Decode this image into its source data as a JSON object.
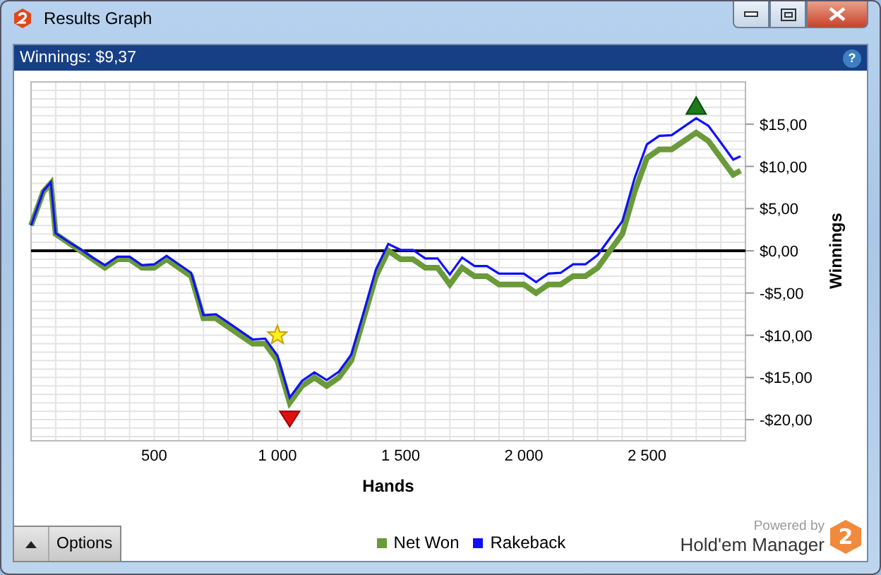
{
  "window": {
    "title": "Results Graph"
  },
  "header": {
    "title": "Winnings: $9,37",
    "help": "?"
  },
  "chart": {
    "chart_data": {
      "type": "line",
      "grid": true,
      "xlabel": "Hands",
      "ylabel": "Winnings",
      "xlim": [
        0,
        2900
      ],
      "ylim": [
        -22.5,
        20
      ],
      "xticks": [
        {
          "value": 500,
          "label": "500"
        },
        {
          "value": 1000,
          "label": "1 000"
        },
        {
          "value": 1500,
          "label": "1 500"
        },
        {
          "value": 2000,
          "label": "2 000"
        },
        {
          "value": 2500,
          "label": "2 500"
        }
      ],
      "yticks": [
        {
          "value": 15,
          "label": "$15,00"
        },
        {
          "value": 10,
          "label": "$10,00"
        },
        {
          "value": 5,
          "label": "$5,00"
        },
        {
          "value": 0,
          "label": "$0,00"
        },
        {
          "value": -5,
          "label": "-$5,00"
        },
        {
          "value": -10,
          "label": "-$10,00"
        },
        {
          "value": -15,
          "label": "-$15,00"
        },
        {
          "value": -20,
          "label": "-$20,00"
        }
      ],
      "x": [
        0,
        50,
        80,
        100,
        150,
        200,
        250,
        300,
        350,
        400,
        450,
        500,
        550,
        600,
        650,
        700,
        750,
        800,
        850,
        900,
        950,
        1000,
        1050,
        1100,
        1150,
        1200,
        1250,
        1300,
        1350,
        1400,
        1450,
        1500,
        1550,
        1600,
        1650,
        1700,
        1750,
        1800,
        1850,
        1900,
        1950,
        2000,
        2050,
        2100,
        2150,
        2200,
        2250,
        2300,
        2350,
        2400,
        2450,
        2500,
        2550,
        2600,
        2650,
        2700,
        2750,
        2800,
        2850,
        2880
      ],
      "series": [
        {
          "name": "Net Won",
          "color": "#6a9a3a",
          "values": [
            3,
            7,
            8,
            2,
            1,
            0,
            -1,
            -2,
            -1,
            -1,
            -2,
            -2,
            -1,
            -2,
            -3,
            -8,
            -8,
            -9,
            -10,
            -11,
            -11,
            -13,
            -18,
            -16,
            -15,
            -16,
            -15,
            -13,
            -8,
            -3,
            0,
            -1,
            -1,
            -2,
            -2,
            -4,
            -2,
            -3,
            -3,
            -4,
            -4,
            -4,
            -5,
            -4,
            -4,
            -3,
            -3,
            -2,
            0,
            2,
            7,
            11,
            12,
            12,
            13,
            14,
            13,
            11,
            9,
            9.5
          ]
        },
        {
          "name": "Rakeback",
          "color": "#1010ff",
          "values": [
            3,
            7.1,
            8.1,
            2.1,
            1.1,
            0.2,
            -0.8,
            -1.7,
            -0.7,
            -0.7,
            -1.7,
            -1.6,
            -0.6,
            -1.6,
            -2.6,
            -7.6,
            -7.5,
            -8.5,
            -9.5,
            -10.5,
            -10.4,
            -12.4,
            -17.4,
            -15.4,
            -14.4,
            -15.3,
            -14.3,
            -12.3,
            -7.3,
            -2.2,
            0.8,
            0.1,
            0.1,
            -0.9,
            -0.9,
            -2.8,
            -0.8,
            -1.8,
            -1.8,
            -2.7,
            -2.7,
            -2.7,
            -3.7,
            -2.7,
            -2.6,
            -1.6,
            -1.6,
            -0.5,
            1.5,
            3.5,
            8.6,
            12.6,
            13.6,
            13.7,
            14.7,
            15.7,
            14.8,
            12.8,
            10.8,
            11.2
          ]
        }
      ]
    }
  },
  "footer": {
    "options": "Options",
    "powered_by": "Powered by",
    "brand": "Hold'em Manager",
    "logo": "2"
  }
}
